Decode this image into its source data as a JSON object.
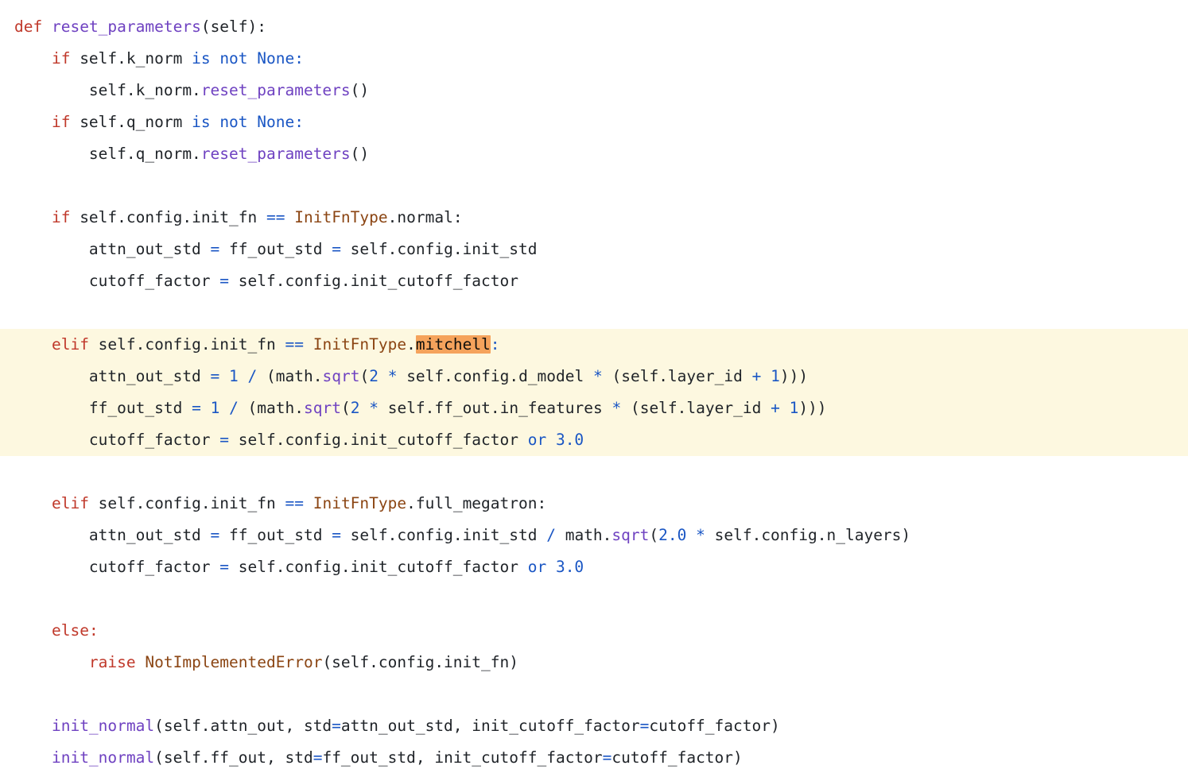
{
  "viewer": {
    "name": "python-code-snippet",
    "language": "python",
    "background_color": "#ffffff",
    "highlight_band_color": "#fdf8e0",
    "search_match_color": "#f5a35c"
  },
  "theme": {
    "plain": "#1f2328",
    "keyword": "#c0392b",
    "function": "#6f42c1",
    "operator": "#1a56c4",
    "number": "#1a56c4",
    "builtin": "#1a56c4",
    "class": "#8b4513",
    "exception": "#8b4513"
  },
  "code": {
    "search_match_text": "mitchell",
    "lines": [
      {
        "highlighted": false,
        "text": "def reset_parameters(self):",
        "tokens": [
          {
            "t": "def",
            "c": "keyword"
          },
          {
            "t": " ",
            "c": "plain"
          },
          {
            "t": "reset_parameters",
            "c": "function"
          },
          {
            "t": "(self):",
            "c": "plain"
          }
        ]
      },
      {
        "highlighted": false,
        "text": "    if self.k_norm is not None:",
        "tokens": [
          {
            "t": "    ",
            "c": "plain"
          },
          {
            "t": "if",
            "c": "keyword"
          },
          {
            "t": " self.k_norm ",
            "c": "plain"
          },
          {
            "t": "is",
            "c": "builtin"
          },
          {
            "t": " ",
            "c": "plain"
          },
          {
            "t": "not",
            "c": "builtin"
          },
          {
            "t": " ",
            "c": "plain"
          },
          {
            "t": "None",
            "c": "builtin"
          },
          {
            "t": ":",
            "c": "builtin"
          }
        ]
      },
      {
        "highlighted": false,
        "text": "        self.k_norm.reset_parameters()",
        "tokens": [
          {
            "t": "        self.k_norm.",
            "c": "plain"
          },
          {
            "t": "reset_parameters",
            "c": "function"
          },
          {
            "t": "()",
            "c": "plain"
          }
        ]
      },
      {
        "highlighted": false,
        "text": "    if self.q_norm is not None:",
        "tokens": [
          {
            "t": "    ",
            "c": "plain"
          },
          {
            "t": "if",
            "c": "keyword"
          },
          {
            "t": " self.q_norm ",
            "c": "plain"
          },
          {
            "t": "is",
            "c": "builtin"
          },
          {
            "t": " ",
            "c": "plain"
          },
          {
            "t": "not",
            "c": "builtin"
          },
          {
            "t": " ",
            "c": "plain"
          },
          {
            "t": "None",
            "c": "builtin"
          },
          {
            "t": ":",
            "c": "builtin"
          }
        ]
      },
      {
        "highlighted": false,
        "text": "        self.q_norm.reset_parameters()",
        "tokens": [
          {
            "t": "        self.q_norm.",
            "c": "plain"
          },
          {
            "t": "reset_parameters",
            "c": "function"
          },
          {
            "t": "()",
            "c": "plain"
          }
        ]
      },
      {
        "highlighted": false,
        "text": "",
        "tokens": []
      },
      {
        "highlighted": false,
        "text": "    if self.config.init_fn == InitFnType.normal:",
        "tokens": [
          {
            "t": "    ",
            "c": "plain"
          },
          {
            "t": "if",
            "c": "keyword"
          },
          {
            "t": " self.config.init_fn ",
            "c": "plain"
          },
          {
            "t": "==",
            "c": "operator"
          },
          {
            "t": " ",
            "c": "plain"
          },
          {
            "t": "InitFnType",
            "c": "class"
          },
          {
            "t": ".normal:",
            "c": "plain"
          }
        ]
      },
      {
        "highlighted": false,
        "text": "        attn_out_std = ff_out_std = self.config.init_std",
        "tokens": [
          {
            "t": "        attn_out_std ",
            "c": "plain"
          },
          {
            "t": "=",
            "c": "operator"
          },
          {
            "t": " ff_out_std ",
            "c": "plain"
          },
          {
            "t": "=",
            "c": "operator"
          },
          {
            "t": " self.config.init_std",
            "c": "plain"
          }
        ]
      },
      {
        "highlighted": false,
        "text": "        cutoff_factor = self.config.init_cutoff_factor",
        "tokens": [
          {
            "t": "        cutoff_factor ",
            "c": "plain"
          },
          {
            "t": "=",
            "c": "operator"
          },
          {
            "t": " self.config.init_cutoff_factor",
            "c": "plain"
          }
        ]
      },
      {
        "highlighted": false,
        "text": "",
        "tokens": []
      },
      {
        "highlighted": true,
        "text": "    elif self.config.init_fn == InitFnType.mitchell:",
        "tokens": [
          {
            "t": "    ",
            "c": "plain"
          },
          {
            "t": "elif",
            "c": "keyword"
          },
          {
            "t": " self.config.init_fn ",
            "c": "plain"
          },
          {
            "t": "==",
            "c": "operator"
          },
          {
            "t": " ",
            "c": "plain"
          },
          {
            "t": "InitFnType",
            "c": "class"
          },
          {
            "t": ".",
            "c": "plain"
          },
          {
            "t": "mitchell",
            "c": "match"
          },
          {
            "t": ":",
            "c": "operator"
          }
        ]
      },
      {
        "highlighted": true,
        "text": "        attn_out_std = 1 / (math.sqrt(2 * self.config.d_model * (self.layer_id + 1)))",
        "tokens": [
          {
            "t": "        attn_out_std ",
            "c": "plain"
          },
          {
            "t": "=",
            "c": "operator"
          },
          {
            "t": " ",
            "c": "plain"
          },
          {
            "t": "1",
            "c": "number"
          },
          {
            "t": " ",
            "c": "plain"
          },
          {
            "t": "/",
            "c": "operator"
          },
          {
            "t": " (math.",
            "c": "plain"
          },
          {
            "t": "sqrt",
            "c": "function"
          },
          {
            "t": "(",
            "c": "plain"
          },
          {
            "t": "2",
            "c": "number"
          },
          {
            "t": " ",
            "c": "plain"
          },
          {
            "t": "*",
            "c": "operator"
          },
          {
            "t": " self.config.d_model ",
            "c": "plain"
          },
          {
            "t": "*",
            "c": "operator"
          },
          {
            "t": " (self.layer_id ",
            "c": "plain"
          },
          {
            "t": "+",
            "c": "operator"
          },
          {
            "t": " ",
            "c": "plain"
          },
          {
            "t": "1",
            "c": "number"
          },
          {
            "t": ")))",
            "c": "plain"
          }
        ]
      },
      {
        "highlighted": true,
        "text": "        ff_out_std = 1 / (math.sqrt(2 * self.ff_out.in_features * (self.layer_id + 1)))",
        "tokens": [
          {
            "t": "        ff_out_std ",
            "c": "plain"
          },
          {
            "t": "=",
            "c": "operator"
          },
          {
            "t": " ",
            "c": "plain"
          },
          {
            "t": "1",
            "c": "number"
          },
          {
            "t": " ",
            "c": "plain"
          },
          {
            "t": "/",
            "c": "operator"
          },
          {
            "t": " (math.",
            "c": "plain"
          },
          {
            "t": "sqrt",
            "c": "function"
          },
          {
            "t": "(",
            "c": "plain"
          },
          {
            "t": "2",
            "c": "number"
          },
          {
            "t": " ",
            "c": "plain"
          },
          {
            "t": "*",
            "c": "operator"
          },
          {
            "t": " self.ff_out.in_features ",
            "c": "plain"
          },
          {
            "t": "*",
            "c": "operator"
          },
          {
            "t": " (self.layer_id ",
            "c": "plain"
          },
          {
            "t": "+",
            "c": "operator"
          },
          {
            "t": " ",
            "c": "plain"
          },
          {
            "t": "1",
            "c": "number"
          },
          {
            "t": ")))",
            "c": "plain"
          }
        ]
      },
      {
        "highlighted": true,
        "text": "        cutoff_factor = self.config.init_cutoff_factor or 3.0",
        "tokens": [
          {
            "t": "        cutoff_factor ",
            "c": "plain"
          },
          {
            "t": "=",
            "c": "operator"
          },
          {
            "t": " self.config.init_cutoff_factor ",
            "c": "plain"
          },
          {
            "t": "or",
            "c": "builtin"
          },
          {
            "t": " ",
            "c": "plain"
          },
          {
            "t": "3.0",
            "c": "number"
          }
        ]
      },
      {
        "highlighted": false,
        "text": "",
        "tokens": []
      },
      {
        "highlighted": false,
        "text": "    elif self.config.init_fn == InitFnType.full_megatron:",
        "tokens": [
          {
            "t": "    ",
            "c": "plain"
          },
          {
            "t": "elif",
            "c": "keyword"
          },
          {
            "t": " self.config.init_fn ",
            "c": "plain"
          },
          {
            "t": "==",
            "c": "operator"
          },
          {
            "t": " ",
            "c": "plain"
          },
          {
            "t": "InitFnType",
            "c": "class"
          },
          {
            "t": ".full_megatron:",
            "c": "plain"
          }
        ]
      },
      {
        "highlighted": false,
        "text": "        attn_out_std = ff_out_std = self.config.init_std / math.sqrt(2.0 * self.config.n_layers)",
        "tokens": [
          {
            "t": "        attn_out_std ",
            "c": "plain"
          },
          {
            "t": "=",
            "c": "operator"
          },
          {
            "t": " ff_out_std ",
            "c": "plain"
          },
          {
            "t": "=",
            "c": "operator"
          },
          {
            "t": " self.config.init_std ",
            "c": "plain"
          },
          {
            "t": "/",
            "c": "operator"
          },
          {
            "t": " math.",
            "c": "plain"
          },
          {
            "t": "sqrt",
            "c": "function"
          },
          {
            "t": "(",
            "c": "plain"
          },
          {
            "t": "2.0",
            "c": "number"
          },
          {
            "t": " ",
            "c": "plain"
          },
          {
            "t": "*",
            "c": "operator"
          },
          {
            "t": " self.config.n_layers)",
            "c": "plain"
          }
        ]
      },
      {
        "highlighted": false,
        "text": "        cutoff_factor = self.config.init_cutoff_factor or 3.0",
        "tokens": [
          {
            "t": "        cutoff_factor ",
            "c": "plain"
          },
          {
            "t": "=",
            "c": "operator"
          },
          {
            "t": " self.config.init_cutoff_factor ",
            "c": "plain"
          },
          {
            "t": "or",
            "c": "builtin"
          },
          {
            "t": " ",
            "c": "plain"
          },
          {
            "t": "3.0",
            "c": "number"
          }
        ]
      },
      {
        "highlighted": false,
        "text": "",
        "tokens": []
      },
      {
        "highlighted": false,
        "text": "    else:",
        "tokens": [
          {
            "t": "    ",
            "c": "plain"
          },
          {
            "t": "else",
            "c": "keyword"
          },
          {
            "t": ":",
            "c": "keyword"
          }
        ]
      },
      {
        "highlighted": false,
        "text": "        raise NotImplementedError(self.config.init_fn)",
        "tokens": [
          {
            "t": "        ",
            "c": "plain"
          },
          {
            "t": "raise",
            "c": "keyword"
          },
          {
            "t": " ",
            "c": "plain"
          },
          {
            "t": "NotImplementedError",
            "c": "exception"
          },
          {
            "t": "(self.config.init_fn)",
            "c": "plain"
          }
        ]
      },
      {
        "highlighted": false,
        "text": "",
        "tokens": []
      },
      {
        "highlighted": false,
        "text": "    init_normal(self.attn_out, std=attn_out_std, init_cutoff_factor=cutoff_factor)",
        "tokens": [
          {
            "t": "    ",
            "c": "plain"
          },
          {
            "t": "init_normal",
            "c": "function"
          },
          {
            "t": "(self.attn_out, std",
            "c": "plain"
          },
          {
            "t": "=",
            "c": "operator"
          },
          {
            "t": "attn_out_std, init_cutoff_factor",
            "c": "plain"
          },
          {
            "t": "=",
            "c": "operator"
          },
          {
            "t": "cutoff_factor)",
            "c": "plain"
          }
        ]
      },
      {
        "highlighted": false,
        "text": "    init_normal(self.ff_out, std=ff_out_std, init_cutoff_factor=cutoff_factor)",
        "tokens": [
          {
            "t": "    ",
            "c": "plain"
          },
          {
            "t": "init_normal",
            "c": "function"
          },
          {
            "t": "(self.ff_out, std",
            "c": "plain"
          },
          {
            "t": "=",
            "c": "operator"
          },
          {
            "t": "ff_out_std, init_cutoff_factor",
            "c": "plain"
          },
          {
            "t": "=",
            "c": "operator"
          },
          {
            "t": "cutoff_factor)",
            "c": "plain"
          }
        ]
      }
    ]
  }
}
